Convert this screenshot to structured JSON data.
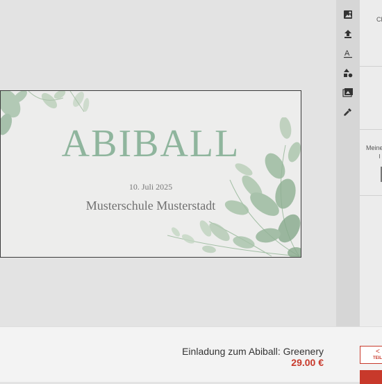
{
  "card": {
    "title": "ABIBALL",
    "date": "10. Juli 2025",
    "school": "Musterschule Musterstadt"
  },
  "toolbar": {
    "tools": [
      "image-add-icon",
      "upload-icon",
      "text-icon",
      "shapes-icon",
      "gallery-icon",
      "eyedropper-icon"
    ]
  },
  "side_panel": {
    "top_label": "Cli",
    "section_label": "Meine"
  },
  "product": {
    "name": "Einladung zum Abiball: Greenery",
    "price": "29.00 €",
    "share_label": "TEIL"
  },
  "colors": {
    "title_green": "#8fb59d",
    "accent_red": "#c8392b",
    "toolbar_bg": "#d6d6d6"
  }
}
